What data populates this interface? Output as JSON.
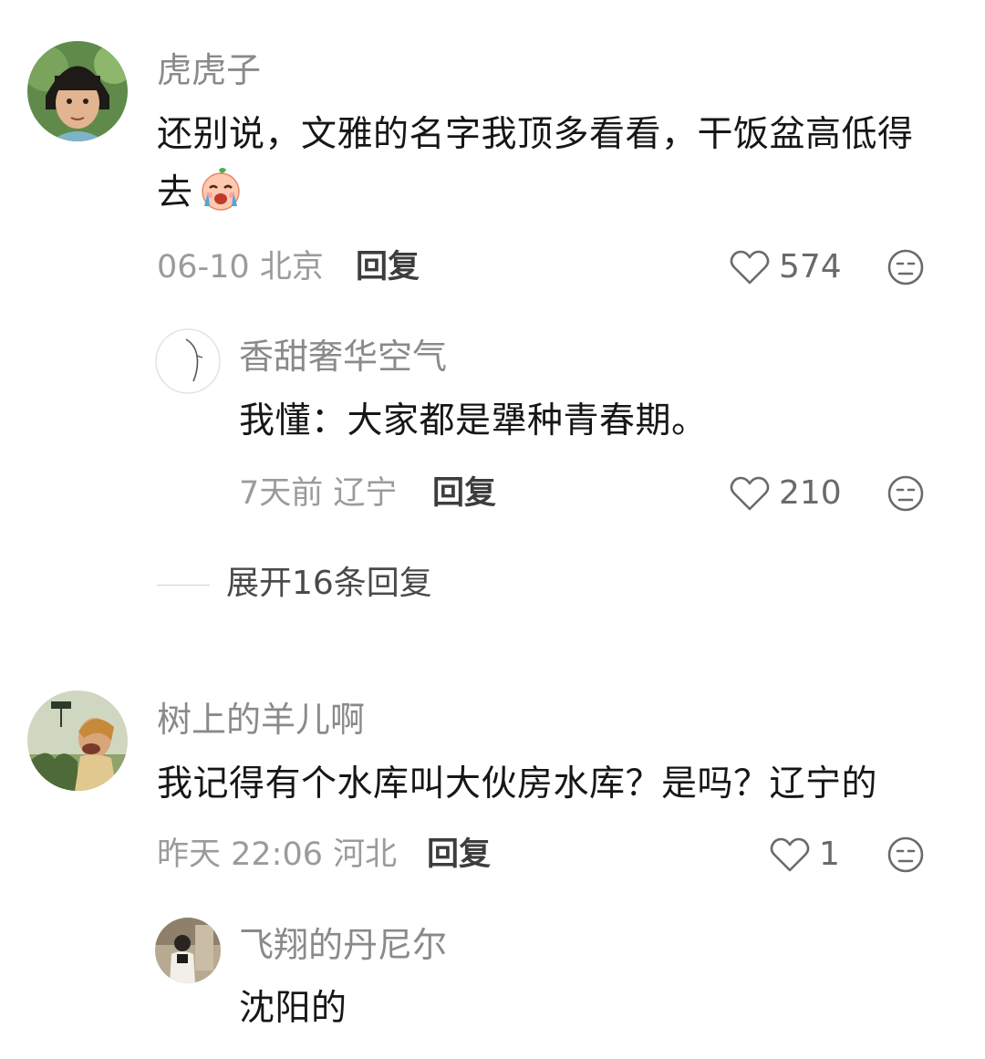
{
  "comments": [
    {
      "username": "虎虎子",
      "text": "还别说，文雅的名字我顶多看看，干饭盆高低得去",
      "emoji": "crying-laughing-emoji",
      "meta": "06-10 北京",
      "reply_label": "回复",
      "likes": "574",
      "replies": [
        {
          "username": "香甜奢华空气",
          "text": "我懂：大家都是犟种青春期。",
          "meta": "7天前 辽宁",
          "reply_label": "回复",
          "likes": "210"
        }
      ],
      "expand_label": "展开16条回复"
    },
    {
      "username": "树上的羊儿啊",
      "text": "我记得有个水库叫大伙房水库？是吗？辽宁的",
      "meta": "昨天 22:06 河北",
      "reply_label": "回复",
      "likes": "1",
      "replies": [
        {
          "username": "飞翔的丹尼尔",
          "text": "沈阳的"
        }
      ]
    }
  ],
  "icons": {
    "like": "heart-outline-icon",
    "dislike": "unamused-face-icon"
  },
  "colors": {
    "username": "#8a8a8a",
    "text": "#161616",
    "meta": "#9b9b9b",
    "reply": "#3d3d3d",
    "background": "#ffffff"
  }
}
